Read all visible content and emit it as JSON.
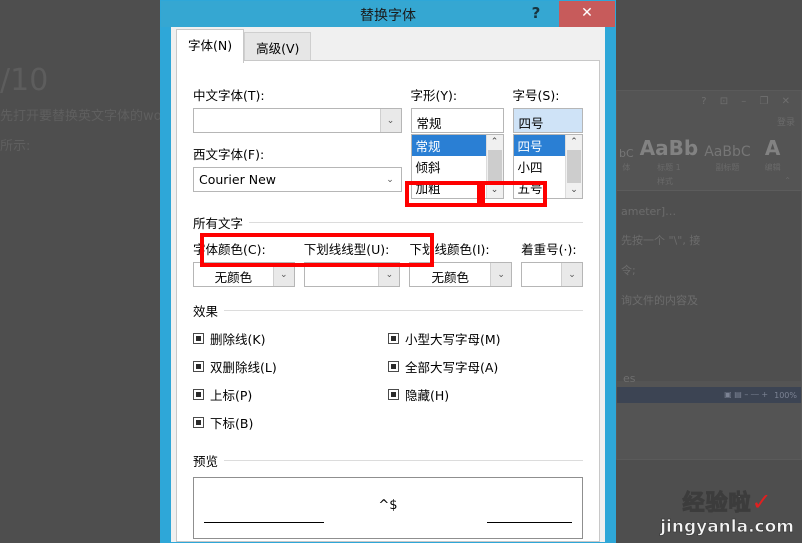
{
  "background": {
    "page_counter": "/10",
    "lines": [
      "先打开要替换英文字体的wo",
      "所示:"
    ],
    "word_window": {
      "titlebar_glyphs": "?  ⊡  –  ❐  ✕",
      "signin": "登录",
      "styles": [
        {
          "glyph": "bC",
          "name": "体"
        },
        {
          "glyph": "AaBb",
          "name": "标题 1"
        },
        {
          "glyph": "AaBbC",
          "name": "副标题"
        }
      ],
      "edit_group": {
        "glyph": "A",
        "name": "编辑"
      },
      "ribbon_group_left": "样式",
      "ribbon_group_right": "⌃",
      "doc_lines": [
        "ameter]…",
        "先按一个 \"\\\", 接",
        "令;",
        "询文件的内容及"
      ],
      "footer_text": "es",
      "statusbar_zoom": "100%",
      "statusbar_glyphs": "▣  ▤  –  ⎯⎯  +"
    },
    "watermark": {
      "line1": "经验啦",
      "check": "✓",
      "line2": "jingyanla.com"
    }
  },
  "dialog": {
    "title": "替换字体",
    "help_label": "?",
    "close_label": "✕",
    "tabs": [
      {
        "label": "字体(N)",
        "active": true
      },
      {
        "label": "高级(V)",
        "active": false
      }
    ],
    "font_section": {
      "chinese_font": {
        "label": "中文字体(T):",
        "value": ""
      },
      "latin_font": {
        "label": "西文字体(F):",
        "value": "Courier New"
      },
      "style": {
        "label": "字形(Y):",
        "value": "常规",
        "options": [
          "常规",
          "倾斜",
          "加粗"
        ],
        "selected_index": 0
      },
      "size": {
        "label": "字号(S):",
        "value": "四号",
        "options": [
          "四号",
          "小四",
          "五号"
        ],
        "selected_index": 0
      }
    },
    "all_text_section": {
      "title": "所有文字",
      "fields": [
        {
          "label": "字体颜色(C):",
          "value": "无颜色"
        },
        {
          "label": "下划线线型(U):",
          "value": ""
        },
        {
          "label": "下划线颜色(I):",
          "value": "无颜色"
        },
        {
          "label": "着重号(·):",
          "value": ""
        }
      ]
    },
    "effects_section": {
      "title": "效果",
      "left_items": [
        {
          "label": "删除线(K)",
          "state": "indeterminate"
        },
        {
          "label": "双删除线(L)",
          "state": "indeterminate"
        },
        {
          "label": "上标(P)",
          "state": "indeterminate"
        },
        {
          "label": "下标(B)",
          "state": "indeterminate"
        }
      ],
      "right_items": [
        {
          "label": "小型大写字母(M)",
          "state": "indeterminate"
        },
        {
          "label": "全部大写字母(A)",
          "state": "indeterminate"
        },
        {
          "label": "隐藏(H)",
          "state": "indeterminate"
        }
      ]
    },
    "preview_section": {
      "title": "预览",
      "text": "^$"
    },
    "scrollbar_arrow": "⌄"
  },
  "colors": {
    "title_bar": "#35a7d2",
    "dialog_border": "#2ea7d8",
    "close_button": "#c75b5b",
    "highlight_select": "#2a7fd4",
    "annotation_red": "#fe0000"
  }
}
